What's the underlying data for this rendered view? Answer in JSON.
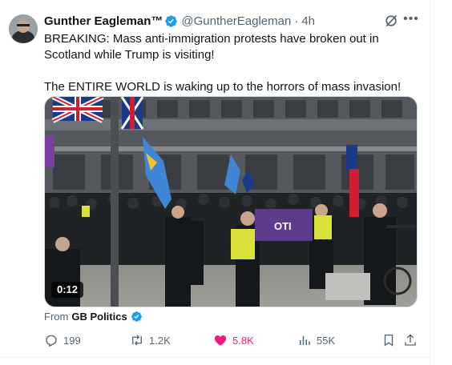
{
  "post": {
    "author_name": "Gunther Eagleman™",
    "handle": "@GuntherEagleman",
    "separator": "·",
    "time": "4h",
    "text_line1": "BREAKING: Mass anti-immigration protests have broken out in Scotland while Trump is visiting!",
    "text_line2": "The ENTIRE WORLD is waking up to the horrors of mass invasion!",
    "more_label": "•••"
  },
  "media": {
    "duration": "0:12",
    "banner_text": "OTI",
    "source_prefix": "From",
    "source_name": "GB Politics"
  },
  "actions": {
    "replies": "199",
    "reposts": "1.2K",
    "likes": "5.8K",
    "views": "55K",
    "liked": true
  },
  "colors": {
    "text": "#0f1419",
    "secondary": "#536471",
    "verified": "#1d9bf0",
    "like": "#f91880",
    "border": "#eff3f4"
  },
  "icons": [
    "verified-badge-icon",
    "grok-icon",
    "more-icon",
    "reply-icon",
    "repost-icon",
    "heart-icon",
    "views-icon",
    "bookmark-icon",
    "share-icon"
  ]
}
